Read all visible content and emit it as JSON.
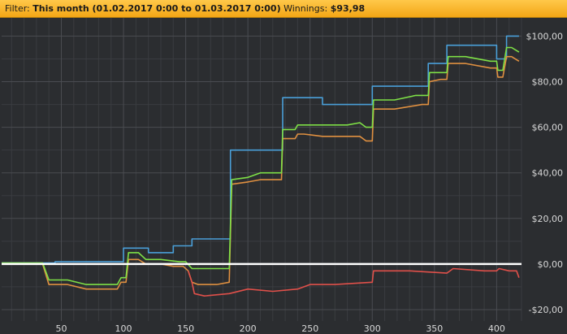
{
  "filter": {
    "label": "Filter:",
    "period": "This month (01.02.2017 0:00 to 01.03.2017 0:00)",
    "winnings_label": "Winnings:",
    "winnings_value": "$93,98"
  },
  "chart_data": {
    "type": "line",
    "title": "",
    "xlabel": "",
    "ylabel": "",
    "xlim": [
      2,
      420
    ],
    "ylim": [
      -25,
      108
    ],
    "x_ticks": [
      50,
      100,
      150,
      200,
      250,
      300,
      350,
      400
    ],
    "y_ticks": [
      -20,
      0,
      20,
      40,
      60,
      80,
      100
    ],
    "y_tick_labels": [
      "-$20,00",
      "$0,00",
      "$20,00",
      "$40,00",
      "$60,00",
      "$80,00",
      "$100,00"
    ],
    "grid": true,
    "zero_line": true,
    "series": [
      {
        "color": "#4a9fd8",
        "points": [
          [
            2,
            0.5
          ],
          [
            45,
            0.5
          ],
          [
            45,
            1
          ],
          [
            78,
            1
          ],
          [
            100,
            1
          ],
          [
            100,
            7
          ],
          [
            120,
            7
          ],
          [
            120,
            5
          ],
          [
            140,
            5
          ],
          [
            140,
            8
          ],
          [
            155,
            8
          ],
          [
            155,
            11
          ],
          [
            168,
            11
          ],
          [
            168,
            11
          ],
          [
            186,
            11
          ],
          [
            186,
            50
          ],
          [
            228,
            50
          ],
          [
            228,
            73
          ],
          [
            260,
            73
          ],
          [
            260,
            70
          ],
          [
            300,
            70
          ],
          [
            300,
            78
          ],
          [
            345,
            78
          ],
          [
            345,
            88
          ],
          [
            360,
            88
          ],
          [
            360,
            96
          ],
          [
            400,
            96
          ],
          [
            400,
            90
          ],
          [
            408,
            90
          ],
          [
            408,
            100
          ],
          [
            418,
            100
          ]
        ]
      },
      {
        "color": "#e09040",
        "points": [
          [
            2,
            0
          ],
          [
            20,
            0
          ],
          [
            35,
            0
          ],
          [
            40,
            -9
          ],
          [
            55,
            -9
          ],
          [
            70,
            -11
          ],
          [
            95,
            -11
          ],
          [
            98,
            -8
          ],
          [
            102,
            -8
          ],
          [
            104,
            2
          ],
          [
            112,
            2
          ],
          [
            118,
            0
          ],
          [
            130,
            0
          ],
          [
            140,
            -1
          ],
          [
            148,
            -1
          ],
          [
            152,
            -3
          ],
          [
            155,
            -8
          ],
          [
            160,
            -9
          ],
          [
            175,
            -9
          ],
          [
            185,
            -8
          ],
          [
            187,
            35
          ],
          [
            200,
            36
          ],
          [
            210,
            37
          ],
          [
            227,
            37
          ],
          [
            228,
            55
          ],
          [
            238,
            55
          ],
          [
            240,
            57
          ],
          [
            245,
            57
          ],
          [
            260,
            56
          ],
          [
            290,
            56
          ],
          [
            295,
            54
          ],
          [
            300,
            54
          ],
          [
            301,
            68
          ],
          [
            318,
            68
          ],
          [
            340,
            70
          ],
          [
            345,
            70
          ],
          [
            346,
            80
          ],
          [
            355,
            81
          ],
          [
            360,
            81
          ],
          [
            361,
            88
          ],
          [
            375,
            88
          ],
          [
            395,
            86
          ],
          [
            400,
            86
          ],
          [
            401,
            82
          ],
          [
            405,
            82
          ],
          [
            408,
            91
          ],
          [
            412,
            91
          ],
          [
            418,
            89
          ]
        ]
      },
      {
        "color": "#7ee046",
        "points": [
          [
            2,
            0.5
          ],
          [
            35,
            0.5
          ],
          [
            40,
            -7
          ],
          [
            55,
            -7
          ],
          [
            70,
            -9
          ],
          [
            95,
            -9
          ],
          [
            98,
            -6
          ],
          [
            102,
            -6
          ],
          [
            104,
            5
          ],
          [
            112,
            5
          ],
          [
            118,
            2
          ],
          [
            130,
            2
          ],
          [
            145,
            1
          ],
          [
            150,
            1
          ],
          [
            155,
            -2
          ],
          [
            160,
            -2
          ],
          [
            175,
            -2
          ],
          [
            185,
            -2
          ],
          [
            187,
            37
          ],
          [
            200,
            38
          ],
          [
            210,
            40
          ],
          [
            227,
            40
          ],
          [
            228,
            59
          ],
          [
            238,
            59
          ],
          [
            240,
            61
          ],
          [
            250,
            61
          ],
          [
            280,
            61
          ],
          [
            290,
            62
          ],
          [
            295,
            60
          ],
          [
            300,
            60
          ],
          [
            301,
            72
          ],
          [
            318,
            72
          ],
          [
            335,
            74
          ],
          [
            345,
            74
          ],
          [
            346,
            84
          ],
          [
            355,
            84
          ],
          [
            360,
            84
          ],
          [
            361,
            91
          ],
          [
            375,
            91
          ],
          [
            395,
            89
          ],
          [
            400,
            89
          ],
          [
            401,
            85
          ],
          [
            405,
            85
          ],
          [
            408,
            95
          ],
          [
            412,
            95
          ],
          [
            418,
            93
          ]
        ]
      },
      {
        "color": "#e0504a",
        "points": [
          [
            152,
            -3
          ],
          [
            155,
            -8
          ],
          [
            157,
            -13
          ],
          [
            165,
            -14
          ],
          [
            185,
            -13
          ],
          [
            200,
            -11
          ],
          [
            220,
            -12
          ],
          [
            240,
            -11
          ],
          [
            250,
            -9
          ],
          [
            270,
            -9
          ],
          [
            300,
            -8
          ],
          [
            301,
            -3
          ],
          [
            330,
            -3
          ],
          [
            360,
            -4
          ],
          [
            365,
            -2
          ],
          [
            390,
            -3
          ],
          [
            400,
            -3
          ],
          [
            402,
            -2
          ],
          [
            410,
            -3
          ],
          [
            416,
            -3
          ],
          [
            418,
            -6
          ]
        ]
      }
    ]
  }
}
